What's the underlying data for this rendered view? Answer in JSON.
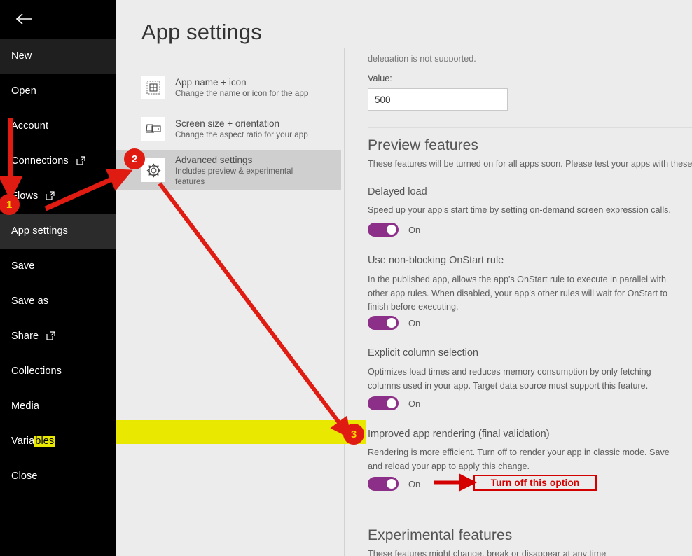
{
  "sidebar": {
    "back_icon": "back-arrow-icon",
    "items": [
      {
        "label": "New",
        "shade": "shade-a",
        "external": false
      },
      {
        "label": "Open",
        "shade": "",
        "external": false
      },
      {
        "label": "Account",
        "shade": "",
        "external": false
      },
      {
        "label": "Connections",
        "shade": "",
        "external": true
      },
      {
        "label": "Flows",
        "shade": "",
        "external": true
      },
      {
        "label": "App settings",
        "shade": "shade-b",
        "external": false
      },
      {
        "label": "Save",
        "shade": "",
        "external": false
      },
      {
        "label": "Save as",
        "shade": "",
        "external": false
      },
      {
        "label": "Share",
        "shade": "",
        "external": true
      },
      {
        "label": "Collections",
        "shade": "",
        "external": false
      },
      {
        "label": "Media",
        "shade": "",
        "external": false
      },
      {
        "label": "Variables",
        "shade": "",
        "external": false
      },
      {
        "label": "Close",
        "shade": "",
        "external": false
      }
    ]
  },
  "middle": {
    "title": "App settings",
    "cards": [
      {
        "title": "App name + icon",
        "subtitle": "Change the name or icon for the app",
        "icon": "app-grid-icon",
        "selected": false
      },
      {
        "title": "Screen size + orientation",
        "subtitle": "Change the aspect ratio for your app",
        "icon": "screen-devices-icon",
        "selected": false
      },
      {
        "title": "Advanced settings",
        "subtitle": "Includes preview & experimental features",
        "icon": "gear-icon",
        "selected": true
      }
    ]
  },
  "right": {
    "clipped_text": "delegation is not supported.",
    "value_label": "Value:",
    "value_field": "500",
    "preview_section": {
      "title": "Preview features",
      "subtitle": "These features will be turned on for all apps soon. Please test your apps with these"
    },
    "features": [
      {
        "title": "Delayed load",
        "description": "Speed up your app's start time by setting on-demand screen expression calls.",
        "toggle_state": "On"
      },
      {
        "title": "Use non-blocking OnStart rule",
        "description": "In the published app, allows the app's OnStart rule to execute in parallel with other app rules. When disabled, your app's other rules will wait for OnStart to finish before executing.",
        "toggle_state": "On"
      },
      {
        "title": "Explicit column selection",
        "description": "Optimizes load times and reduces memory consumption by only fetching columns used in your app. Target data source must support this feature.",
        "toggle_state": "On"
      },
      {
        "title": "Improved app rendering (final validation)",
        "description": "Rendering is more efficient. Turn off to render your app in classic mode. Save and reload your app to apply this change.",
        "toggle_state": "On"
      }
    ],
    "experimental_section": {
      "title": "Experimental features",
      "subtitle": "These features might change, break or disappear at any time"
    }
  },
  "annotations": {
    "badge_1": "1",
    "badge_2": "2",
    "badge_3": "3",
    "callout_label": "Turn off this option",
    "accent_red": "#e01b12",
    "highlight_yellow": "#e8e800",
    "toggle_purple": "#8c2f88"
  }
}
